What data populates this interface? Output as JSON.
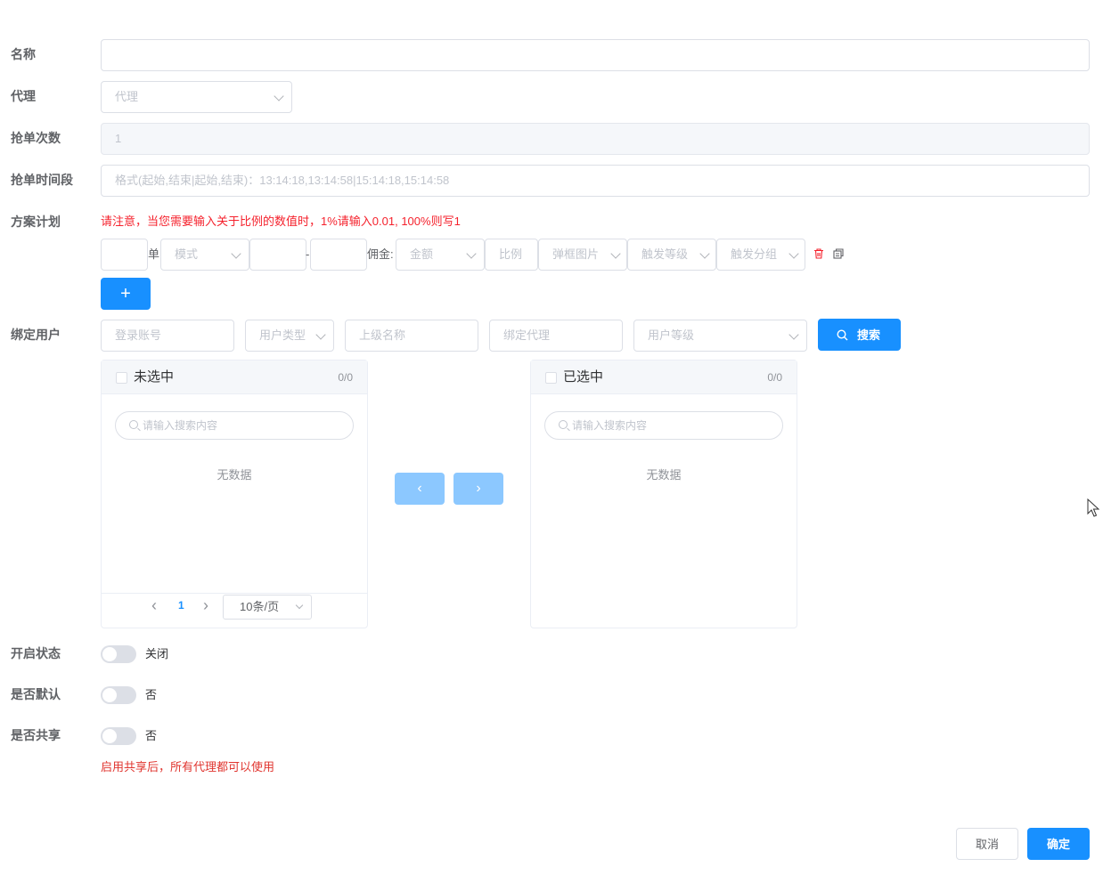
{
  "form": {
    "name": {
      "label": "名称",
      "value": ""
    },
    "agent": {
      "label": "代理",
      "placeholder": "代理"
    },
    "grab_count": {
      "label": "抢单次数",
      "value": "1"
    },
    "grab_period": {
      "label": "抢单时间段",
      "placeholder": "格式(起始,结束|起始,结束)：13:14:18,13:14:58|15:14:18,15:14:58"
    },
    "plan": {
      "label": "方案计划",
      "notice": "请注意，当您需要输入关于比例的数值时，1%请输入0.01, 100%则写1",
      "row": {
        "unit": "单",
        "mode_placeholder": "模式",
        "range_sep": "-",
        "commission_label": "佣金:",
        "amount_placeholder": "金额",
        "ratio_placeholder": "比例",
        "popup_image_placeholder": "弹框图片",
        "trigger_level_placeholder": "触发等级",
        "trigger_group_placeholder": "触发分组"
      },
      "add_label": "+"
    },
    "bind_user": {
      "label": "绑定用户",
      "filters": {
        "login_account": "登录账号",
        "user_type": "用户类型",
        "parent_name": "上级名称",
        "bound_agent": "绑定代理",
        "user_level": "用户等级"
      },
      "search_label": "搜索"
    },
    "transfer": {
      "left": {
        "title": "未选中",
        "count": "0/0",
        "search_placeholder": "请输入搜索内容",
        "empty": "无数据"
      },
      "right": {
        "title": "已选中",
        "count": "0/0",
        "search_placeholder": "请输入搜索内容",
        "empty": "无数据"
      },
      "pagination": {
        "prev": "‹",
        "page": "1",
        "next": "›",
        "page_size": "10条/页"
      },
      "to_left": "‹",
      "to_right": "›"
    },
    "enable_status": {
      "label": "开启状态",
      "state_text": "关闭"
    },
    "is_default": {
      "label": "是否默认",
      "state_text": "否"
    },
    "is_shared": {
      "label": "是否共享",
      "state_text": "否",
      "hint": "启用共享后，所有代理都可以使用"
    }
  },
  "footer": {
    "cancel_label": "取消",
    "confirm_label": "确定"
  },
  "colors": {
    "primary": "#1890ff",
    "danger": "#f5222d",
    "border": "#dcdfe6"
  }
}
